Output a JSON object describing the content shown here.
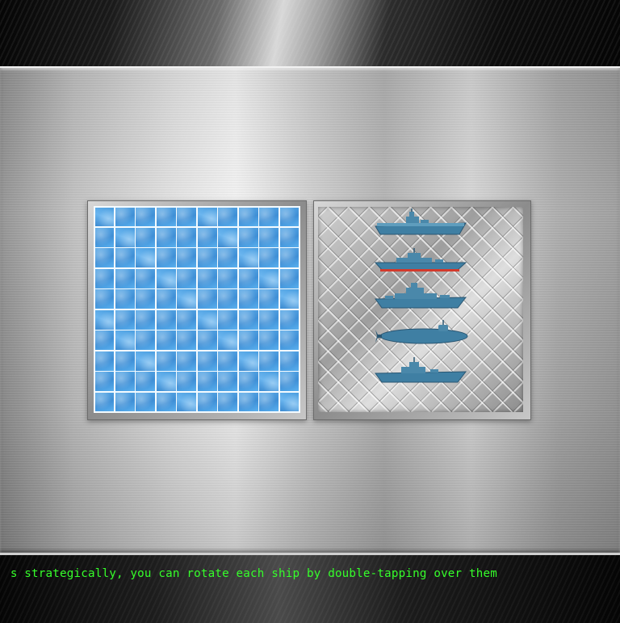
{
  "game": {
    "instruction_text": "s strategically, you can rotate each ship by double-tapping over them"
  },
  "board": {
    "rows": 10,
    "cols": 10
  },
  "fleet": {
    "ships": [
      {
        "icon": "aircraft-carrier-icon"
      },
      {
        "icon": "destroyer-icon"
      },
      {
        "icon": "cruiser-icon"
      },
      {
        "icon": "submarine-icon"
      },
      {
        "icon": "patrol-ship-icon"
      }
    ]
  },
  "colors": {
    "instruction_text": "#35ff2a",
    "water_cell": "#4a9ee0",
    "grid_line": "#f4fbff",
    "ship_hull": "#3f7fa3",
    "ship_waterline": "#d33a2c"
  }
}
